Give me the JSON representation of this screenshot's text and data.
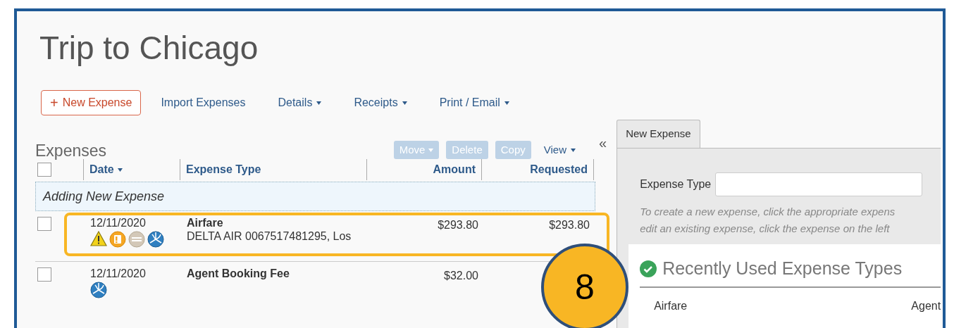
{
  "title": "Trip to Chicago",
  "toolbar": [
    {
      "label": "New Expense",
      "kind": "add",
      "icon": "+"
    },
    {
      "label": "Import Expenses",
      "kind": "link"
    },
    {
      "label": "Details",
      "kind": "menu"
    },
    {
      "label": "Receipts",
      "kind": "menu"
    },
    {
      "label": "Print / Email",
      "kind": "menu"
    }
  ],
  "expenses": {
    "heading": "Expenses",
    "actions": [
      {
        "label": "Move",
        "disabled": true,
        "menu": true
      },
      {
        "label": "Delete",
        "disabled": true,
        "menu": false
      },
      {
        "label": "Copy",
        "disabled": true,
        "menu": false
      },
      {
        "label": "View",
        "disabled": false,
        "menu": true
      }
    ],
    "collapse": "«",
    "select_all": {
      "checked": false
    },
    "columns": [
      {
        "label": "Date",
        "sorted": true
      },
      {
        "label": "Expense Type",
        "sorted": false
      },
      {
        "label": "Amount",
        "sorted": false
      },
      {
        "label": "Requested",
        "sorted": false
      }
    ],
    "adding_row": "Adding New Expense",
    "rows": [
      {
        "checked": false,
        "highlighted": true,
        "date": "12/11/2020",
        "icons": [
          {
            "kind": "warning"
          },
          {
            "kind": "alert"
          },
          {
            "kind": "blocked"
          },
          {
            "kind": "globe"
          }
        ],
        "type": "Airfare",
        "description": "DELTA AIR 0067517481295, Los",
        "amount": "$293.80",
        "requested": "$293.80"
      },
      {
        "checked": false,
        "highlighted": false,
        "date": "12/11/2020",
        "icons": [
          {
            "kind": "globe"
          }
        ],
        "type": "Agent Booking Fee",
        "amount": "$32.00"
      }
    ]
  },
  "callout": {
    "label": "8"
  },
  "side_panel": {
    "tabs": [
      {
        "label": "New Expense",
        "selected": true
      }
    ],
    "field": {
      "label": "Expense Type"
    },
    "hint": [
      "To create a new expense, click the appropriate expens",
      "edit an existing expense, click the expense on the left"
    ],
    "recent": {
      "heading": "Recently Used Expense Types",
      "items": [
        "Airfare",
        "Agent"
      ]
    }
  }
}
